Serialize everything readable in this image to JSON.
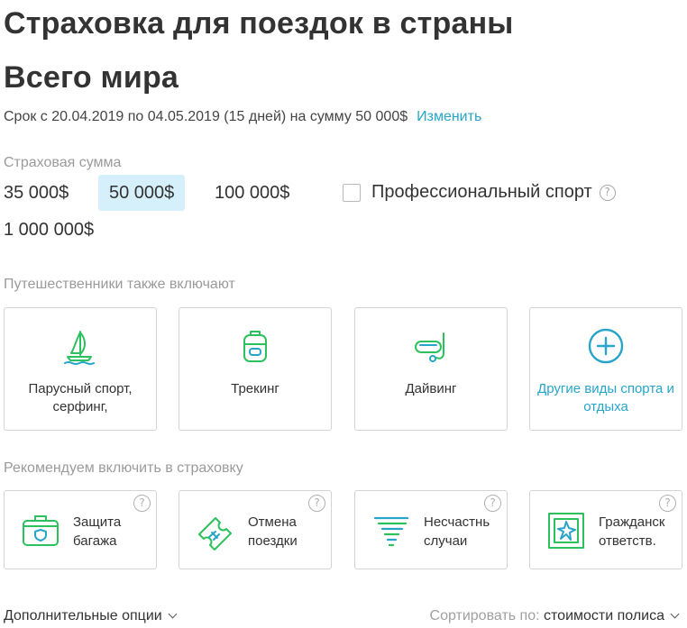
{
  "colors": {
    "accent": "#27a5c9",
    "icon_green": "#2cc15c",
    "selected_bg": "#d6f0fb"
  },
  "header": {
    "title_line1": "Страховка для поездок в страны",
    "title_line2": "Всего мира"
  },
  "term": {
    "text": "Срок с 20.04.2019 по 04.05.2019 (15 дней) на сумму 50 000$",
    "change_link": "Изменить"
  },
  "insured_sum": {
    "label": "Страховая сумма",
    "options": [
      "35 000$",
      "50 000$",
      "100 000$",
      "1 000 000$"
    ],
    "selected": "50 000$",
    "pro_sport_label": "Профессиональный спорт",
    "pro_sport_checked": false
  },
  "travelers": {
    "label": "Путешественники также включают",
    "cards": [
      {
        "icon": "windsurf-icon",
        "label": "Парусный спорт, серфинг,"
      },
      {
        "icon": "backpack-icon",
        "label": "Трекинг"
      },
      {
        "icon": "diving-mask-icon",
        "label": "Дайвинг"
      },
      {
        "icon": "plus-circle-icon",
        "label": "Другие виды спорта и отдыха"
      }
    ]
  },
  "recommended": {
    "label": "Рекомендуем включить в страховку",
    "cards": [
      {
        "icon": "luggage-icon",
        "label": "Защита\nбагажа"
      },
      {
        "icon": "ticket-cancel-icon",
        "label": "Отмена\nпоездки"
      },
      {
        "icon": "tornado-icon",
        "label": "Несчастнь\nслучаи"
      },
      {
        "icon": "broken-window-icon",
        "label": "Гражданск\nответств."
      }
    ]
  },
  "footer": {
    "more_options": "Дополнительные опции",
    "sort_label": "Сортировать по:",
    "sort_value": "стоимости полиса"
  }
}
